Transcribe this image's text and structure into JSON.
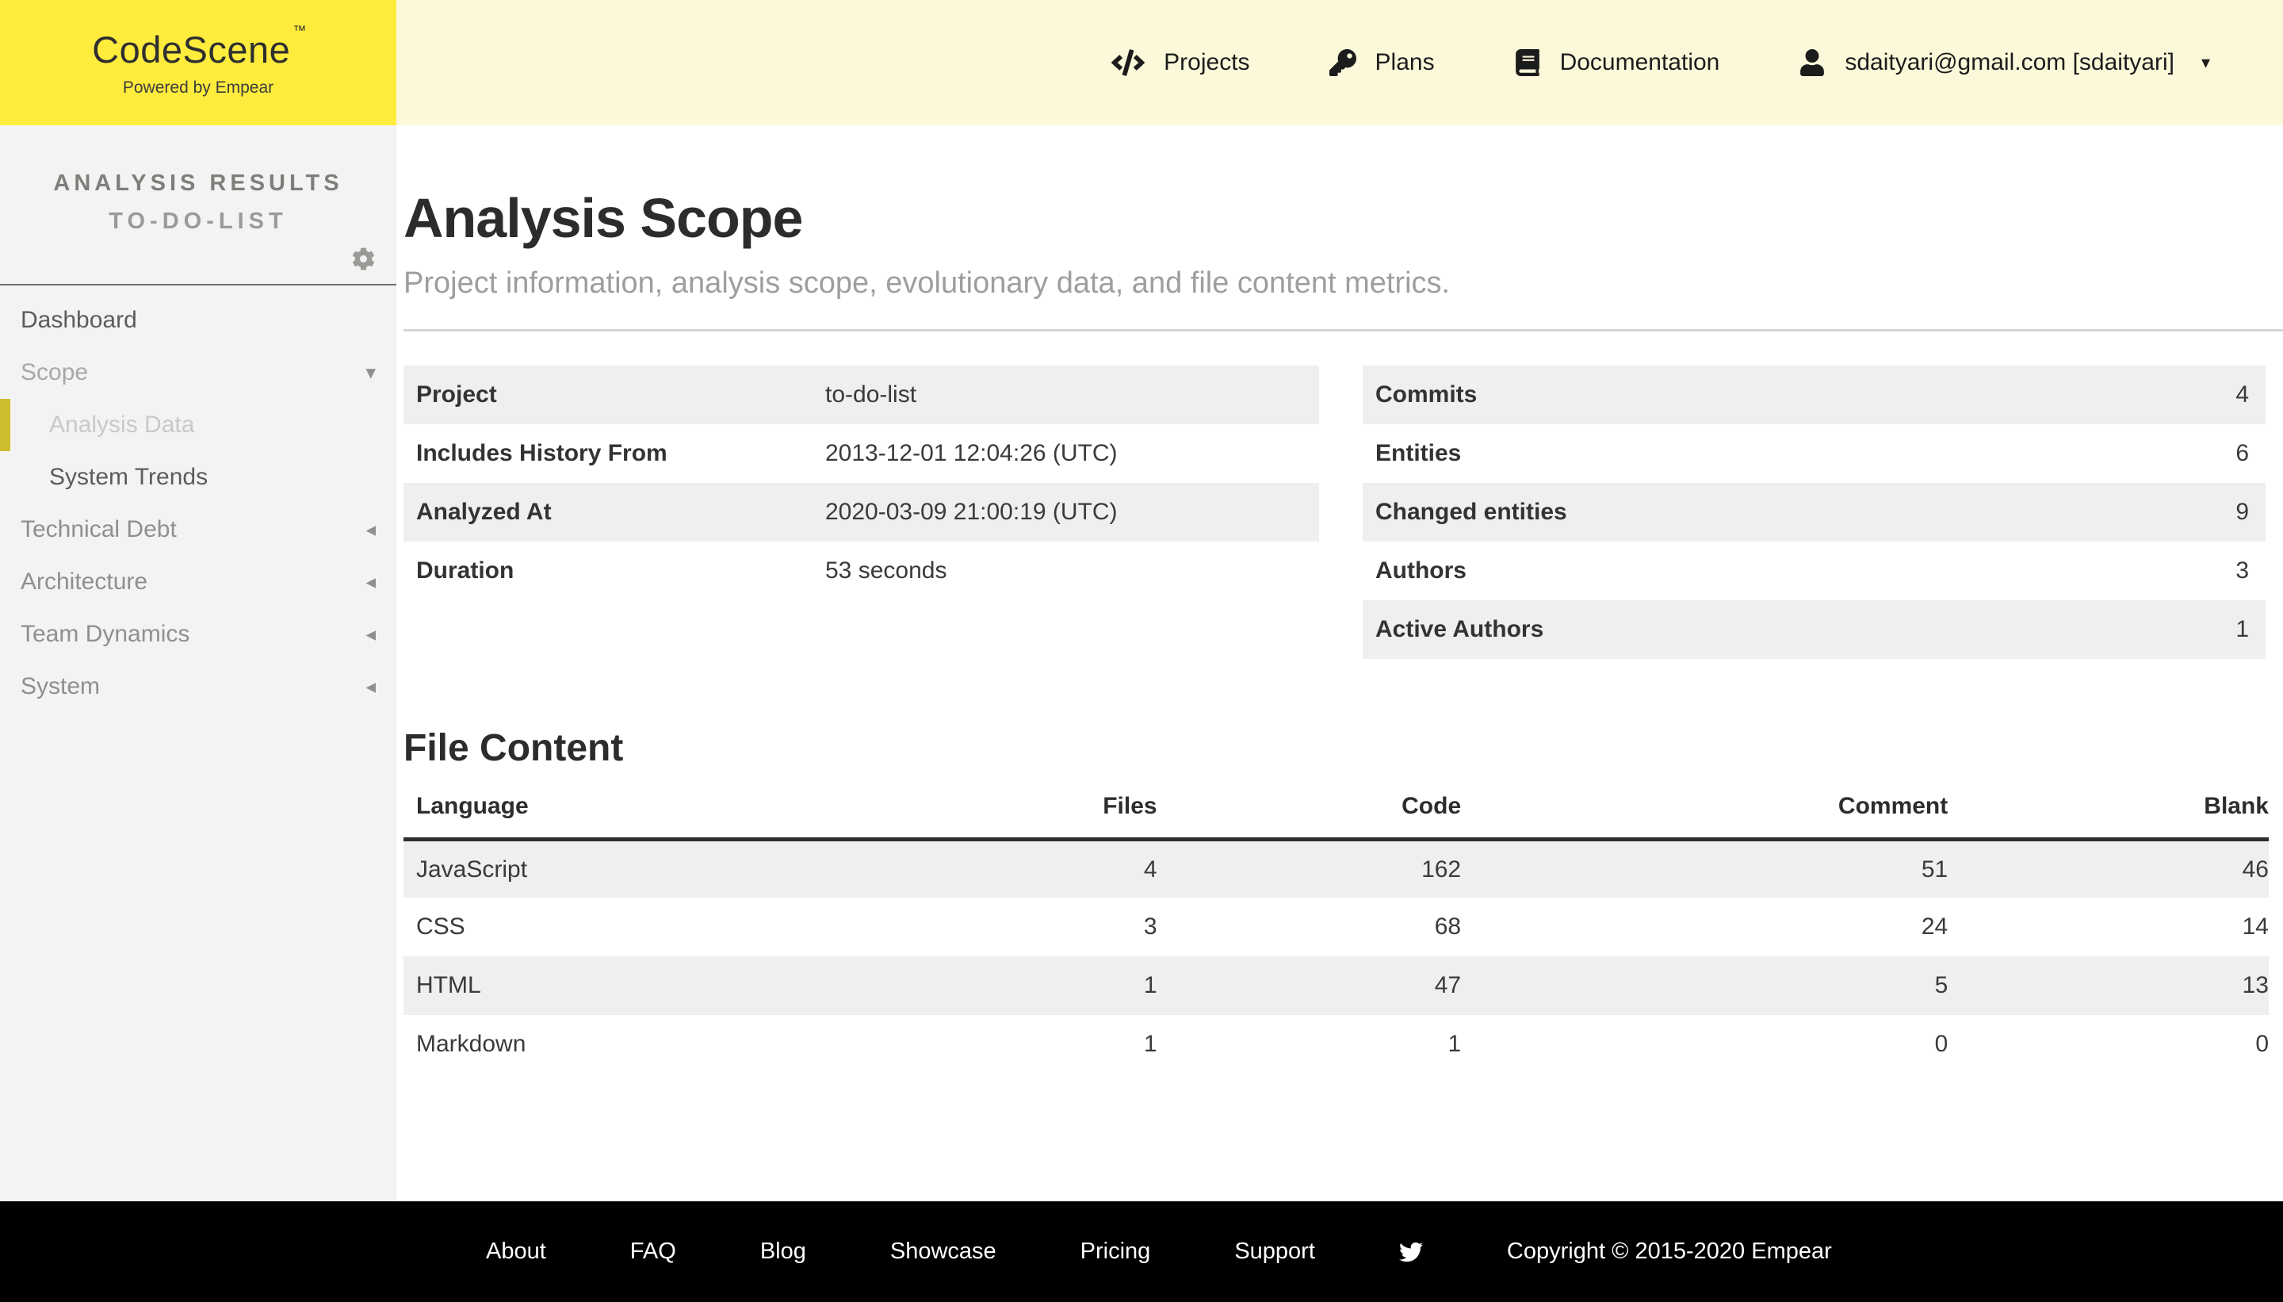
{
  "header": {
    "logo": {
      "brand": "CodeScene",
      "tm": "™",
      "tagline": "Powered by Empear"
    },
    "nav": [
      {
        "label": "Projects",
        "icon": "code-icon"
      },
      {
        "label": "Plans",
        "icon": "key-icon"
      },
      {
        "label": "Documentation",
        "icon": "book-icon"
      },
      {
        "label": "sdaityari@gmail.com [sdaityari]",
        "icon": "user-icon",
        "caret": "▾"
      }
    ]
  },
  "sidebar": {
    "title_line1": "ANALYSIS RESULTS",
    "title_line2": "TO-DO-LIST",
    "gear_icon": "gear-icon",
    "items": [
      {
        "label": "Dashboard",
        "caret": ""
      },
      {
        "label": "Scope",
        "caret": "▾"
      },
      {
        "label": "Analysis Data",
        "caret": ""
      },
      {
        "label": "System Trends",
        "caret": ""
      },
      {
        "label": "Technical Debt",
        "caret": "◂"
      },
      {
        "label": "Architecture",
        "caret": "◂"
      },
      {
        "label": "Team Dynamics",
        "caret": "◂"
      },
      {
        "label": "System",
        "caret": "◂"
      }
    ]
  },
  "main": {
    "title": "Analysis Scope",
    "subtitle": "Project information, analysis scope, evolutionary data, and file content metrics.",
    "info_table": {
      "rows": [
        {
          "label": "Project",
          "value": "to-do-list"
        },
        {
          "label": "Includes History From",
          "value": "2013-12-01 12:04:26 (UTC)"
        },
        {
          "label": "Analyzed At",
          "value": "2020-03-09 21:00:19 (UTC)"
        },
        {
          "label": "Duration",
          "value": "53 seconds"
        }
      ]
    },
    "stats_table": {
      "rows": [
        {
          "label": "Commits",
          "value": "4"
        },
        {
          "label": "Entities",
          "value": "6"
        },
        {
          "label": "Changed entities",
          "value": "9"
        },
        {
          "label": "Authors",
          "value": "3"
        },
        {
          "label": "Active Authors",
          "value": "1"
        }
      ]
    },
    "file_content": {
      "heading": "File Content",
      "columns": [
        "Language",
        "Files",
        "Code",
        "Comment",
        "Blank"
      ],
      "rows": [
        {
          "language": "JavaScript",
          "files": "4",
          "code": "162",
          "comment": "51",
          "blank": "46"
        },
        {
          "language": "CSS",
          "files": "3",
          "code": "68",
          "comment": "24",
          "blank": "14"
        },
        {
          "language": "HTML",
          "files": "1",
          "code": "47",
          "comment": "5",
          "blank": "13"
        },
        {
          "language": "Markdown",
          "files": "1",
          "code": "1",
          "comment": "0",
          "blank": "0"
        }
      ]
    }
  },
  "footer": {
    "links": [
      "About",
      "FAQ",
      "Blog",
      "Showcase",
      "Pricing",
      "Support"
    ],
    "twitter_icon": "twitter-icon",
    "copyright": "Copyright © 2015-2020 Empear"
  },
  "colors": {
    "brand_yellow": "#ffec3d",
    "header_yellow": "#fcf9da",
    "sidebar_bg": "#f4f3f3",
    "active_accent": "#cebd2f",
    "row_stripe": "#efefef",
    "footer_bg": "#000000"
  }
}
